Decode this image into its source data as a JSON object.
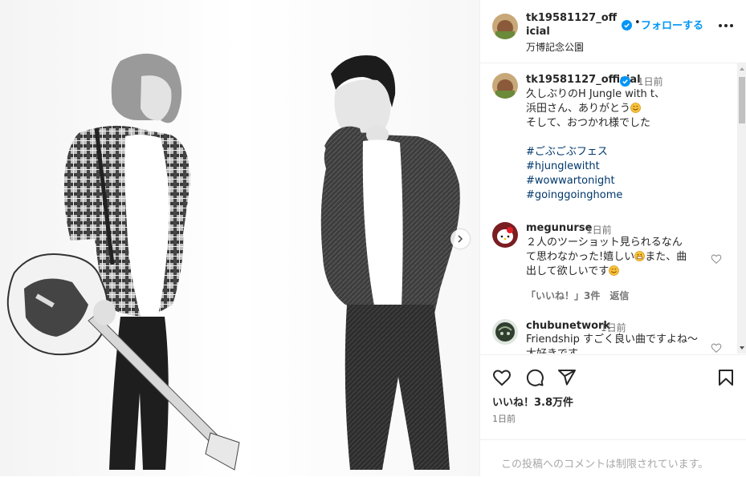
{
  "post": {
    "account": "tk19581127_official",
    "follow_label": "フォローする",
    "separator": "•",
    "location": "万博記念公園"
  },
  "caption": {
    "account": "tk19581127_official",
    "time": "1日前",
    "line1": "久しぶりのH Jungle with t、",
    "line2": "浜田さん、ありがとう",
    "line3": "そして、おつかれ様でした",
    "hashtags": [
      "#ごぶごぶフェス",
      "#hjunglewitht",
      "#wowwartonight",
      "#goinggoinghome"
    ]
  },
  "comments": [
    {
      "user": "megunurse",
      "time": "1日前",
      "line1": "２人のツーショット見られるなん",
      "line2": "て思わなかった!嬉しい",
      "line2b": "また、曲",
      "line3": "出して欲しいです",
      "likes_label": "「いいね！」3件",
      "reply_label": "返信"
    },
    {
      "user": "chubunetwork",
      "time": "1日前",
      "line1": "Friendship すごく良い曲ですよね～",
      "line2": "大好きです"
    }
  ],
  "actions": {
    "likes": "いいね！3.8万件",
    "date": "1日前"
  },
  "comments_limited": "この投稿へのコメントは制限されています。",
  "colors": {
    "accent": "#0095f6",
    "hashtag": "#00376b",
    "muted": "#737373",
    "text": "#262626"
  },
  "icons": [
    "chevron-right-icon",
    "verified-badge-icon",
    "more-options-icon",
    "heart-icon",
    "comment-icon",
    "share-icon",
    "bookmark-icon"
  ]
}
